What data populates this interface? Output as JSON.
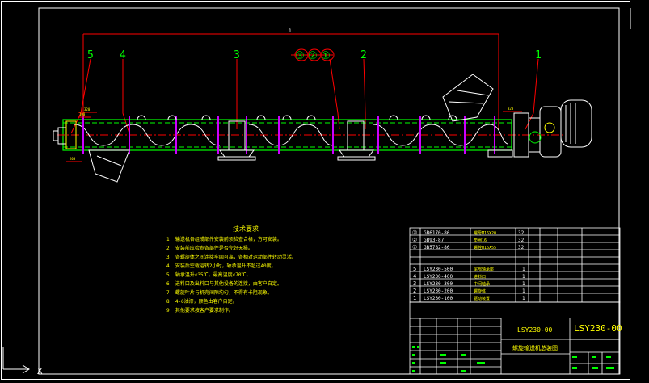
{
  "drawing": {
    "colors": {
      "background": "#000000",
      "frame": "#ffffff",
      "red": "#ff0000",
      "green": "#00ff00",
      "yellow": "#ffff00",
      "magenta": "#cc00ff",
      "white": "#ffffff"
    },
    "dimension_top": "1",
    "balloons": [
      "5",
      "4",
      "3",
      "③",
      "②",
      "①",
      "2",
      "1"
    ],
    "small_dims": [
      "320",
      "100",
      "200",
      "320"
    ],
    "technical_requirements": {
      "title": "技术要求",
      "items": [
        "1. 输送机各组成部件安装前须检查合格，方可安装。",
        "2. 安装前应检查各部件是否完好无损。",
        "3. 各螺旋体之间连接牢固可靠，各相对运动部件转动灵活。",
        "4. 安装后空载运转2小时，轴承温升不超过40度。",
        "5. 轴承温升<35℃，最高温度<70℃。",
        "6. 进料口及出料口与其他设备的连接，由客户自定。",
        "7. 螺旋叶片与机壳间隙均匀，不得有卡阻现象。",
        "8. 4-6油漆，颜色由客户自定。",
        "9. 其他要求按客户要求制作。"
      ]
    },
    "parts_list": [
      {
        "no": "③",
        "code": "GB6170-86",
        "name": "螺母M16X20",
        "qty": "32"
      },
      {
        "no": "②",
        "code": "GB93-87",
        "name": "垫圈16",
        "qty": "32"
      },
      {
        "no": "①",
        "code": "GB5782-86",
        "name": "螺栓M16X55",
        "qty": "32"
      },
      {
        "no": "5",
        "code": "LSY230-500",
        "name": "尾部轴承座",
        "qty": "1"
      },
      {
        "no": "4",
        "code": "LSY230-400",
        "name": "进料口",
        "qty": "1"
      },
      {
        "no": "3",
        "code": "LSY230-300",
        "name": "中间轴承",
        "qty": "1"
      },
      {
        "no": "2",
        "code": "LSY230-200",
        "name": "螺旋体",
        "qty": "1"
      },
      {
        "no": "1",
        "code": "LSY230-100",
        "name": "驱动装置",
        "qty": "1"
      }
    ],
    "title_block": {
      "drawing_no": "LSY230-00",
      "drawing_no_large": "LSY230-00",
      "title": "螺旋输送机总装图"
    },
    "ucs_axis": "X"
  }
}
